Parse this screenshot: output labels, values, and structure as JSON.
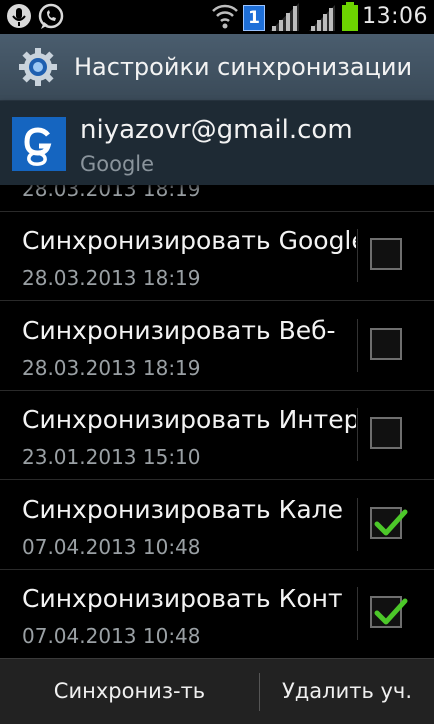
{
  "status_bar": {
    "time": "13:06",
    "sim_badge": "1",
    "icons": [
      "microphone-icon",
      "whatsapp-icon",
      "wifi-icon",
      "sim-icon",
      "signal-icon",
      "signal-icon",
      "battery-icon"
    ]
  },
  "action_bar": {
    "title": "Настройки синхронизации",
    "icon": "settings-gear-icon"
  },
  "account": {
    "email": "niyazovr@gmail.com",
    "provider": "Google",
    "icon": "google-g-icon"
  },
  "sync_items": [
    {
      "label": "",
      "date": "28.03.2013 18:19",
      "checked": false,
      "partial": true
    },
    {
      "label": "Синхронизировать Google",
      "date": "28.03.2013 18:19",
      "checked": false
    },
    {
      "label": "Синхронизировать Веб-",
      "date": "28.03.2013 18:19",
      "checked": false
    },
    {
      "label": "Синхронизировать Интер",
      "date": "23.01.2013 15:10",
      "checked": false
    },
    {
      "label": "Синхронизировать Кале",
      "date": "07.04.2013 10:48",
      "checked": true
    },
    {
      "label": "Синхронизировать Конт",
      "date": "07.04.2013 10:48",
      "checked": true
    }
  ],
  "bottom_bar": {
    "sync_label": "Синхрониз-ть",
    "delete_label": "Удалить уч."
  },
  "colors": {
    "action_bar": "#4a5d6e",
    "account_header": "#1e2a34",
    "check_green": "#4cc829",
    "battery_green": "#6dd400"
  }
}
